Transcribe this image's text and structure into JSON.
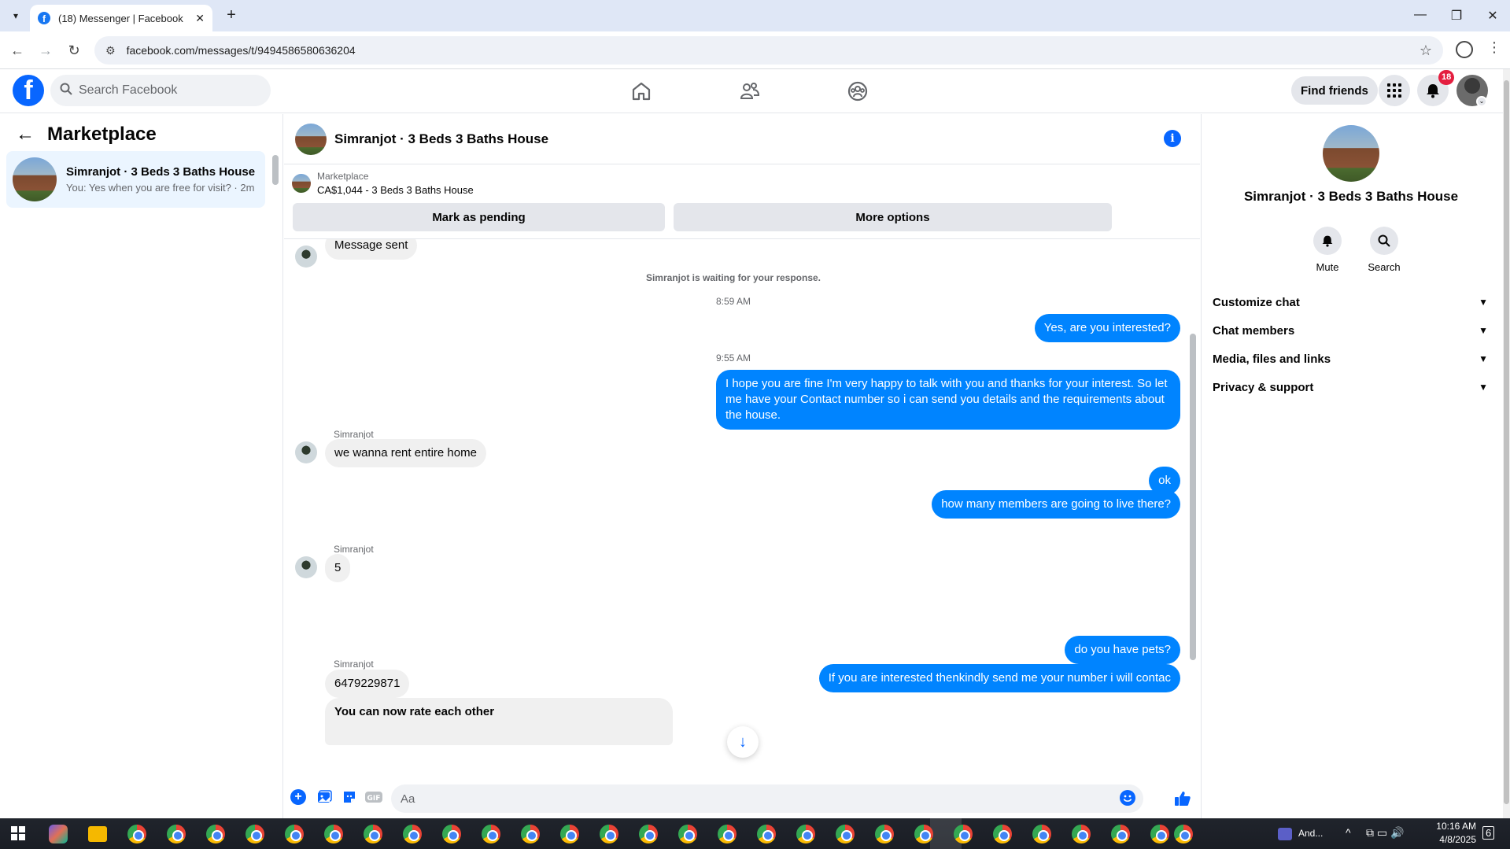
{
  "browser": {
    "tab_title": "(18) Messenger | Facebook",
    "url": "facebook.com/messages/t/9494586580636204"
  },
  "fb": {
    "search_placeholder": "Search Facebook",
    "find_friends": "Find friends",
    "notif_count": "18"
  },
  "left": {
    "title": "Marketplace",
    "conversation": {
      "name": "Simranjot · 3 Beds 3 Baths House",
      "preview": "You: Yes when you are free for visit? · 2m"
    }
  },
  "chat": {
    "title": "Simranjot · 3 Beds 3 Baths House",
    "marketplace_label": "Marketplace",
    "listing": "CA$1,044 - 3 Beds 3 Baths House",
    "btn_pending": "Mark as pending",
    "btn_more": "More options",
    "messages": {
      "m1": "Message sent",
      "waiting": "Simranjot is waiting for your response.",
      "t1": "8:59 AM",
      "m2": "Yes, are you interested?",
      "t2": "9:55 AM",
      "m3_l1": "I hope you are fine I'm very happy to talk with you and thanks for your interest. So let",
      "m3_l2": "me have your Contact number so i can send you details and the requirements about",
      "m3_l3": "the house.",
      "sender": "Simranjot",
      "m4": "we wanna rent entire home",
      "m5": "ok",
      "m6": "how many members are going to live there?",
      "m7": "5",
      "m8": "do you have pets?",
      "m9": "If you are interested thenkindly send me your number i will contac",
      "m10": "6479229871",
      "m11": "You can now rate each other"
    },
    "composer_placeholder": "Aa"
  },
  "right": {
    "name": "Simranjot · 3 Beds 3 Baths House",
    "mute": "Mute",
    "search": "Search",
    "rows": [
      "Customize chat",
      "Chat members",
      "Media, files and links",
      "Privacy & support"
    ]
  },
  "taskbar": {
    "media": "And...",
    "time": "10:16 AM",
    "date": "4/8/2025",
    "notif": "6"
  }
}
